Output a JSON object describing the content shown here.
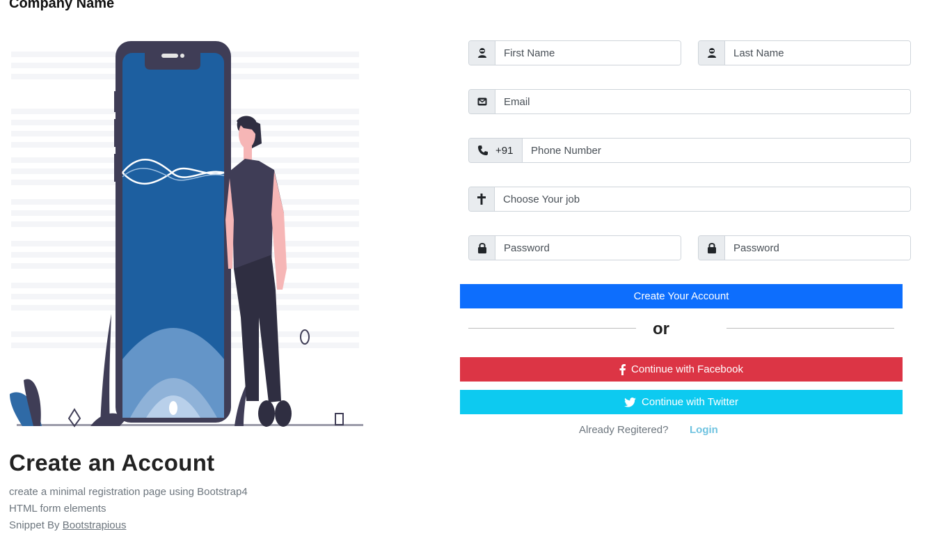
{
  "brand": {
    "name": "Company Name"
  },
  "hero": {
    "title": "Create an Account",
    "line1": "create a minimal registration page using Bootstrap4",
    "line2": "HTML form elements",
    "credit_prefix": "Snippet By ",
    "credit_link": "Bootstrapious"
  },
  "form": {
    "first_name": {
      "placeholder": "First Name",
      "value": ""
    },
    "last_name": {
      "placeholder": "Last Name",
      "value": ""
    },
    "email": {
      "placeholder": "Email",
      "value": ""
    },
    "phone": {
      "code": "+91",
      "placeholder": "Phone Number",
      "value": ""
    },
    "job": {
      "placeholder": "Choose Your job",
      "value": ""
    },
    "password": {
      "placeholder": "Password",
      "value": ""
    },
    "confirm_password": {
      "placeholder": "Password",
      "value": ""
    },
    "submit_label": "Create Your Account",
    "or_label": "or",
    "facebook_label": "Continue with Facebook",
    "twitter_label": "Continue with Twitter",
    "already_label": "Already Regitered?",
    "login_label": "Login"
  },
  "colors": {
    "primary": "#0d6efd",
    "facebook": "#dc3545",
    "twitter": "#0dcaf0",
    "login_link": "#6fc3e0"
  },
  "icons": {
    "first_name": "user-icon",
    "last_name": "user-icon",
    "email": "envelope-icon",
    "phone": "phone-icon",
    "job": "cross-icon",
    "password": "lock-icon",
    "facebook": "facebook-icon",
    "twitter": "twitter-icon"
  }
}
